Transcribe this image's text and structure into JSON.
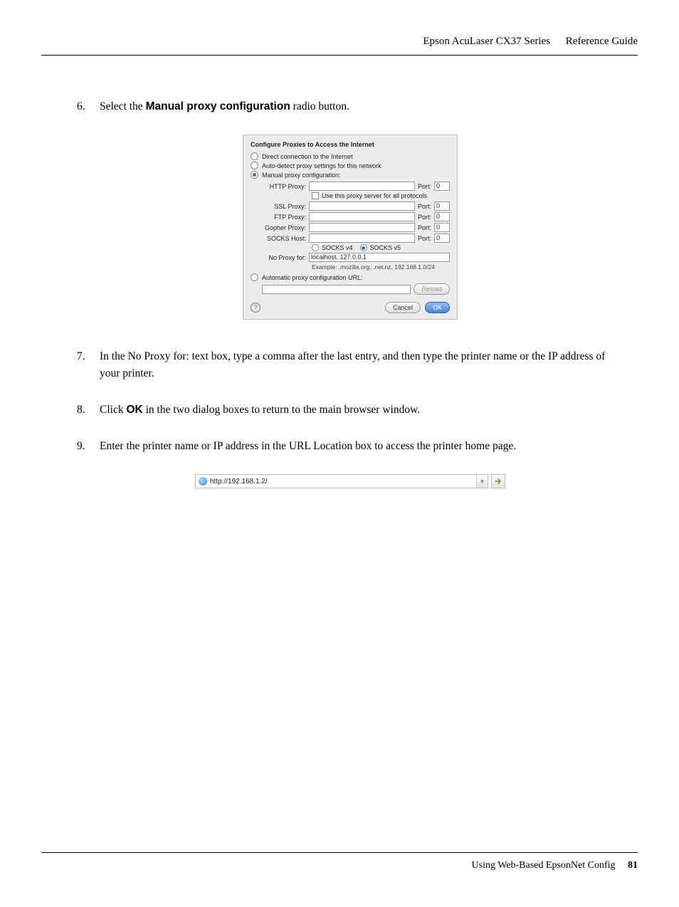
{
  "header": {
    "series": "Epson AcuLaser CX37 Series",
    "guide": "Reference Guide"
  },
  "steps": {
    "s6": {
      "num": "6.",
      "pre": "Select the ",
      "bold": "Manual proxy configuration",
      "post": " radio button."
    },
    "s7": {
      "num": "7.",
      "text": "In the No Proxy for: text box, type a comma after the last entry, and then type the printer name or the IP address of your printer."
    },
    "s8": {
      "num": "8.",
      "pre": "Click ",
      "bold": "OK",
      "post": " in the two dialog boxes to return to the main browser window."
    },
    "s9": {
      "num": "9.",
      "text": "Enter the printer name or IP address in the URL Location box to access the printer home page."
    }
  },
  "dialog": {
    "title": "Configure Proxies to Access the Internet",
    "opt_direct": "Direct connection to the Internet",
    "opt_auto": "Auto-detect proxy settings for this network",
    "opt_manual": "Manual proxy configuration:",
    "http_label": "HTTP Proxy:",
    "port_label": "Port:",
    "use_all": "Use this proxy server for all protocols",
    "ssl_label": "SSL Proxy:",
    "ftp_label": "FTP Proxy:",
    "gopher_label": "Gopher Proxy:",
    "socks_label": "SOCKS Host:",
    "socks_v4": "SOCKS v4",
    "socks_v5": "SOCKS v5",
    "noproxy_label": "No Proxy for:",
    "noproxy_value": "localhost, 127.0.0.1",
    "example": "Example: .mozilla.org, .net.nz, 192.168.1.0/24",
    "auto_url": "Automatic proxy configuration URL:",
    "port_val": "0",
    "reload": "Reload",
    "cancel": "Cancel",
    "ok": "OK",
    "help": "?"
  },
  "urlbar": {
    "url": "http://192.168.1.2/"
  },
  "footer": {
    "section": "Using Web-Based EpsonNet Config",
    "page": "81"
  }
}
